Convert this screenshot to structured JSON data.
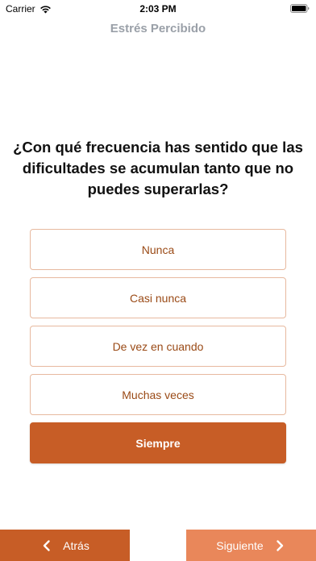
{
  "status_bar": {
    "carrier": "Carrier",
    "time": "2:03 PM"
  },
  "nav": {
    "title": "Estrés Percibido"
  },
  "question": {
    "text": "¿Con qué frecuencia has sentido que las dificultades se acumulan tanto que no puedes superarlas?"
  },
  "options": [
    {
      "label": "Nunca",
      "selected": false
    },
    {
      "label": "Casi nunca",
      "selected": false
    },
    {
      "label": "De vez en cuando",
      "selected": false
    },
    {
      "label": "Muchas veces",
      "selected": false
    },
    {
      "label": "Siempre",
      "selected": true
    }
  ],
  "footer": {
    "back_label": "Atrás",
    "next_label": "Siguiente"
  },
  "colors": {
    "accent": "#c75d26",
    "accent_light": "#e9875a",
    "option_border": "#e7b99f",
    "option_text": "#9a4a16",
    "title_gray": "#9aa0a8"
  },
  "icons": {
    "wifi": "wifi-icon",
    "battery": "battery-icon",
    "back": "chevron-left-icon",
    "next": "chevron-right-icon"
  }
}
